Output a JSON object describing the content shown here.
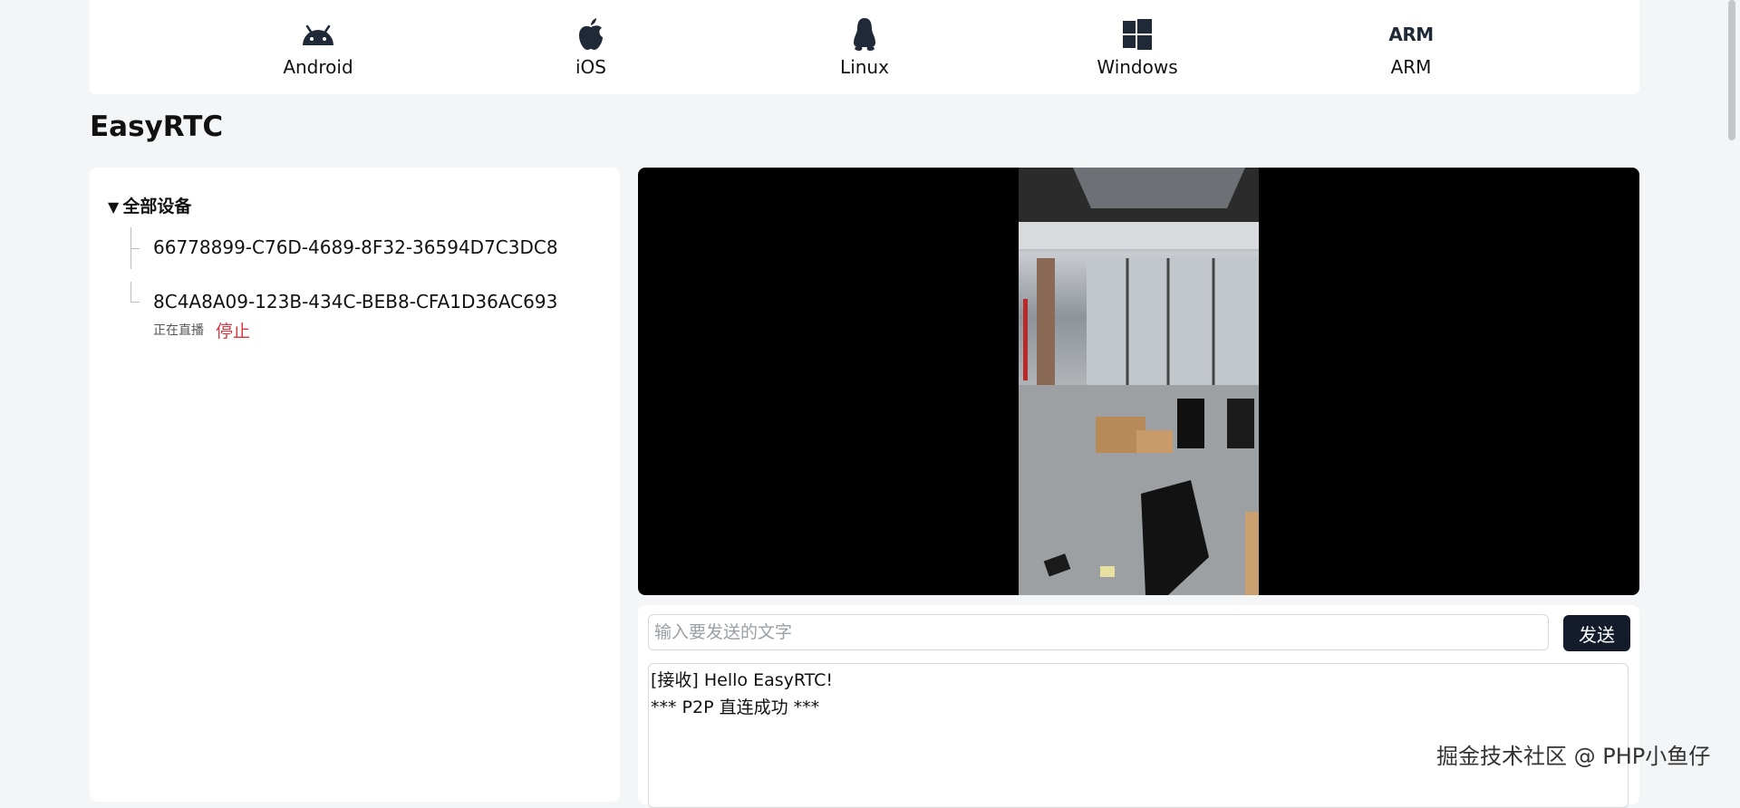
{
  "platforms": [
    {
      "label": "Android",
      "icon": "android-icon"
    },
    {
      "label": "iOS",
      "icon": "apple-icon"
    },
    {
      "label": "Linux",
      "icon": "linux-penguin-icon"
    },
    {
      "label": "Windows",
      "icon": "windows-icon"
    },
    {
      "label": "ARM",
      "icon": "arm-logo-icon",
      "glyph": "ARM"
    }
  ],
  "page_title": "EasyRTC",
  "device_tree": {
    "root_label": "全部设备",
    "devices": [
      {
        "id": "66778899-C76D-4689-8F32-36594D7C3DC8"
      },
      {
        "id": "8C4A8A09-123B-434C-BEB8-CFA1D36AC693",
        "status": "正在直播",
        "action": "停止"
      }
    ]
  },
  "chat": {
    "input_placeholder": "输入要发送的文字",
    "input_value": "",
    "send_label": "发送",
    "messages": [
      "[接收] Hello EasyRTC!",
      "*** P2P 直连成功 ***"
    ]
  },
  "watermark": "掘金技术社区 @ PHP小鱼仔",
  "colors": {
    "background": "#f4f5f7",
    "send_button": "#141c2b",
    "stop_link": "#d9363e",
    "video_background": "#000000"
  }
}
